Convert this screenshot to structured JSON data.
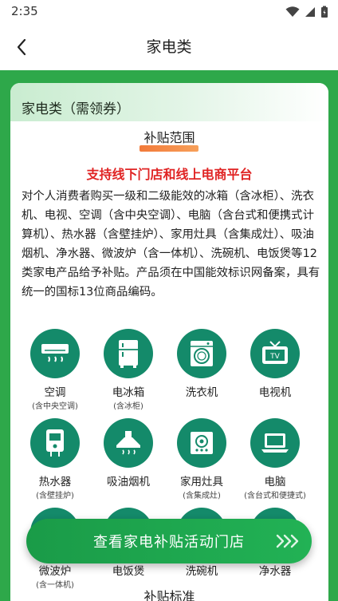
{
  "status_bar": {
    "time": "2:35"
  },
  "nav": {
    "title": "家电类"
  },
  "card": {
    "title": "家电类（需领券）",
    "section_title": "补贴范围",
    "headline": "支持线下门店和线上电商平台",
    "description": "对个人消费者购买一级和二级能效的冰箱（含冰柜）、洗衣机、电视、空调（含中央空调）、电脑（含台式和便携式计算机）、热水器（含壁挂炉）、家用灶具（含集成灶）、吸油烟机、净水器、微波炉（含一体机）、洗碗机、电饭煲等12类家电产品给予补贴。产品须在中国能效标识网备案，具有统一的国标13位商品编码。",
    "categories": [
      {
        "name": "空调",
        "sub": "(含中央空调)",
        "icon": "air-conditioner-icon"
      },
      {
        "name": "电冰箱",
        "sub": "(含冰柜)",
        "icon": "refrigerator-icon"
      },
      {
        "name": "洗衣机",
        "sub": "",
        "icon": "washing-machine-icon"
      },
      {
        "name": "电视机",
        "sub": "",
        "icon": "tv-icon"
      },
      {
        "name": "热水器",
        "sub": "(含壁挂炉)",
        "icon": "water-heater-icon"
      },
      {
        "name": "吸油烟机",
        "sub": "",
        "icon": "range-hood-icon"
      },
      {
        "name": "家用灶具",
        "sub": "(含集成灶)",
        "icon": "stove-icon"
      },
      {
        "name": "电脑",
        "sub": "(含台式和便捷式)",
        "icon": "computer-icon"
      },
      {
        "name": "微波炉",
        "sub": "(含一体机)",
        "icon": "microwave-icon"
      },
      {
        "name": "电饭煲",
        "sub": "",
        "icon": "rice-cooker-icon"
      },
      {
        "name": "洗碗机",
        "sub": "",
        "icon": "dishwasher-icon"
      },
      {
        "name": "净水器",
        "sub": "",
        "icon": "water-purifier-icon"
      }
    ],
    "bottom_title": "补贴标准"
  },
  "cta": {
    "label": "查看家电补贴活动门店"
  },
  "colors": {
    "brand_green": "#2ea84a",
    "icon_teal": "#148a6a",
    "headline_red": "#e02424",
    "accent_orange": "#f27a3a"
  }
}
